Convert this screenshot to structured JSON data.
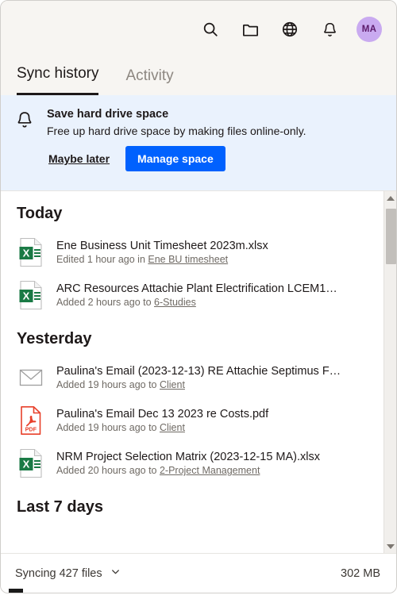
{
  "header": {
    "icons": [
      {
        "name": "search-icon",
        "label": "Search"
      },
      {
        "name": "folder-icon",
        "label": "Files"
      },
      {
        "name": "globe-icon",
        "label": "Web"
      },
      {
        "name": "bell-icon",
        "label": "Notifications"
      }
    ],
    "avatar": {
      "initials": "MA",
      "bg": "#c9aaf0",
      "fg": "#5c1a6b"
    },
    "tabs": [
      {
        "label": "Sync history",
        "active": true
      },
      {
        "label": "Activity",
        "active": false
      }
    ]
  },
  "banner": {
    "icon": "bell-icon",
    "title": "Save hard drive space",
    "description": "Free up hard drive space by making files online-only.",
    "secondary_label": "Maybe later",
    "primary_label": "Manage space",
    "primary_color": "#0061fe",
    "bg": "#eaf2fd"
  },
  "groups": [
    {
      "title": "Today",
      "items": [
        {
          "icon": "excel-file-icon",
          "name": "Ene Business Unit Timesheet 2023m.xlsx",
          "action": "Edited 1 hour ago in ",
          "location": "Ene BU timesheet"
        },
        {
          "icon": "excel-file-icon",
          "name": "ARC Resources Attachie Plant Electrification LCEM1…",
          "action": "Added 2 hours ago to ",
          "location": "6-Studies"
        }
      ]
    },
    {
      "title": "Yesterday",
      "items": [
        {
          "icon": "email-file-icon",
          "name": "Paulina's Email (2023-12-13) RE Attachie Septimus F…",
          "action": "Added 19 hours ago to ",
          "location": "Client"
        },
        {
          "icon": "pdf-file-icon",
          "name": "Paulina's Email Dec 13 2023 re Costs.pdf",
          "action": "Added 19 hours ago to ",
          "location": "Client"
        },
        {
          "icon": "excel-file-icon",
          "name": "NRM Project Selection Matrix (2023-12-15 MA).xlsx",
          "action": "Added 20 hours ago to ",
          "location": "2-Project Management"
        }
      ]
    },
    {
      "title": "Last 7 days",
      "items": []
    }
  ],
  "statusbar": {
    "sync_text": "Syncing 427 files",
    "chevron": "chevron-down-icon",
    "size_text": "302 MB"
  }
}
